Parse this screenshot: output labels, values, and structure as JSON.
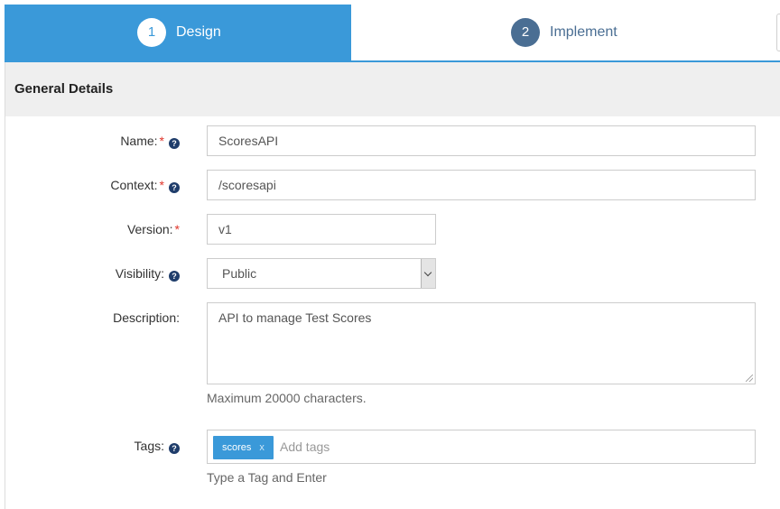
{
  "wizard": {
    "steps": [
      {
        "number": "1",
        "label": "Design",
        "active": true
      },
      {
        "number": "2",
        "label": "Implement",
        "active": false
      }
    ]
  },
  "section": {
    "title": "General Details"
  },
  "form": {
    "name": {
      "label": "Name:",
      "required": "*",
      "help": "?",
      "value": "ScoresAPI"
    },
    "context": {
      "label": "Context:",
      "required": "*",
      "help": "?",
      "value": "/scoresapi"
    },
    "version": {
      "label": "Version:",
      "required": "*",
      "value": "v1"
    },
    "visibility": {
      "label": "Visibility:",
      "help": "?",
      "selected": "Public"
    },
    "description": {
      "label": "Description:",
      "value": "API to manage Test Scores",
      "hint": "Maximum 20000 characters."
    },
    "tags": {
      "label": "Tags:",
      "help": "?",
      "items": [
        {
          "text": "scores",
          "remove": "x"
        }
      ],
      "placeholder": "Add tags",
      "hint": "Type a Tag and Enter"
    }
  },
  "colors": {
    "accent": "#3a99d9",
    "step_inactive": "#4a6e93",
    "required": "#e0352b",
    "section_bg": "#efefef"
  },
  "icons": {
    "help": "question-circle-icon",
    "step_arrow": "chevron-right-icon",
    "select_caret": "chevron-down-icon",
    "tag_remove": "close-icon"
  }
}
